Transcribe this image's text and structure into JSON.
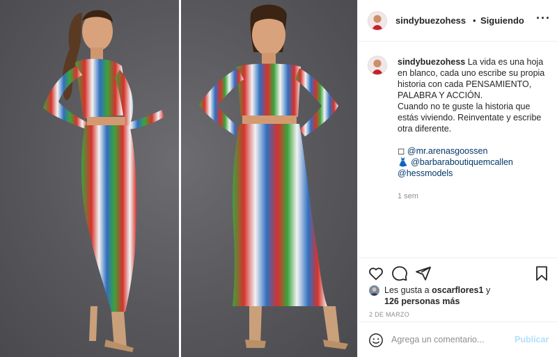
{
  "post": {
    "username": "sindybuezohess",
    "separator": "•",
    "follow_status": "Siguiendo",
    "more_icon": "more-horizontal-icon"
  },
  "photo": {
    "description_colors": [
      "#d6322c",
      "#2f6fc0",
      "#3ba33a",
      "#f0f0f0"
    ]
  },
  "caption": {
    "username": "sindybuezohess",
    "lines": [
      "La vida es una hoja en blanco, cada uno escribe su propia historia con cada PENSAMIENTO, PALABRA Y ACCIÓN.",
      "Cuando no te guste la historia que estás viviendo. Reinventate y escribe otra diferente."
    ],
    "credits": [
      {
        "prefix": "◻",
        "mention": "@mr.arenasgoossen"
      },
      {
        "prefix": "👗",
        "mention": "@barbaraboutiquemcallen"
      },
      {
        "prefix": "",
        "mention": "@hessmodels"
      }
    ],
    "time": "1 sem"
  },
  "actions": {
    "icons": [
      "heart-icon",
      "comment-icon",
      "share-icon",
      "bookmark-icon"
    ]
  },
  "likes": {
    "prefix": "Les gusta a ",
    "user": "oscarflores1",
    "conjunction": " y",
    "others": "126 personas más"
  },
  "date": "2 DE MARZO",
  "comment_box": {
    "placeholder": "Agrega un comentario...",
    "post_label": "Publicar"
  },
  "colors": {
    "link": "#00376b",
    "muted": "#8e8e8e",
    "post_disabled": "#b2dffc",
    "border": "#efefef"
  }
}
